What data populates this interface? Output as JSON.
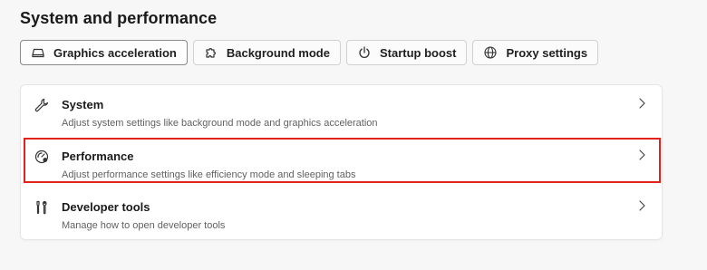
{
  "page": {
    "title": "System and performance"
  },
  "chips": [
    {
      "label": "Graphics acceleration",
      "icon": "graphics-card-icon",
      "active": true
    },
    {
      "label": "Background mode",
      "icon": "puzzle-icon",
      "active": false
    },
    {
      "label": "Startup boost",
      "icon": "power-icon",
      "active": false
    },
    {
      "label": "Proxy settings",
      "icon": "globe-icon",
      "active": false
    }
  ],
  "rows": [
    {
      "title": "System",
      "description": "Adjust system settings like background mode and graphics acceleration",
      "icon": "wrench-icon"
    },
    {
      "title": "Performance",
      "description": "Adjust performance settings like efficiency mode and sleeping tabs",
      "icon": "speedometer-icon"
    },
    {
      "title": "Developer tools",
      "description": "Manage how to open developer tools",
      "icon": "tools-icon"
    }
  ],
  "colors": {
    "highlight": "#e0241b",
    "background": "#f7f7f7",
    "card": "#ffffff"
  }
}
